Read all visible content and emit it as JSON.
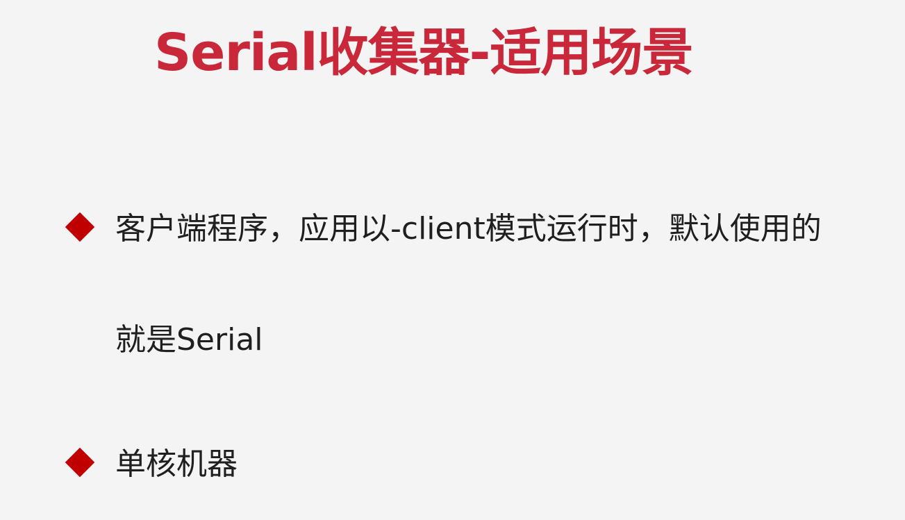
{
  "slide": {
    "title": "Serial收集器-适用场景",
    "bullets": [
      {
        "text": "客户端程序，应用以-client模式运行时，默认使用的就是Serial"
      },
      {
        "text": "单核机器"
      }
    ]
  },
  "colors": {
    "title": "#c8283a",
    "bullet_marker": "#c00000",
    "text": "#1f1f1f",
    "background": "#f4f4f4"
  },
  "icons": {
    "bullet_marker": "diamond-bullet-icon"
  }
}
